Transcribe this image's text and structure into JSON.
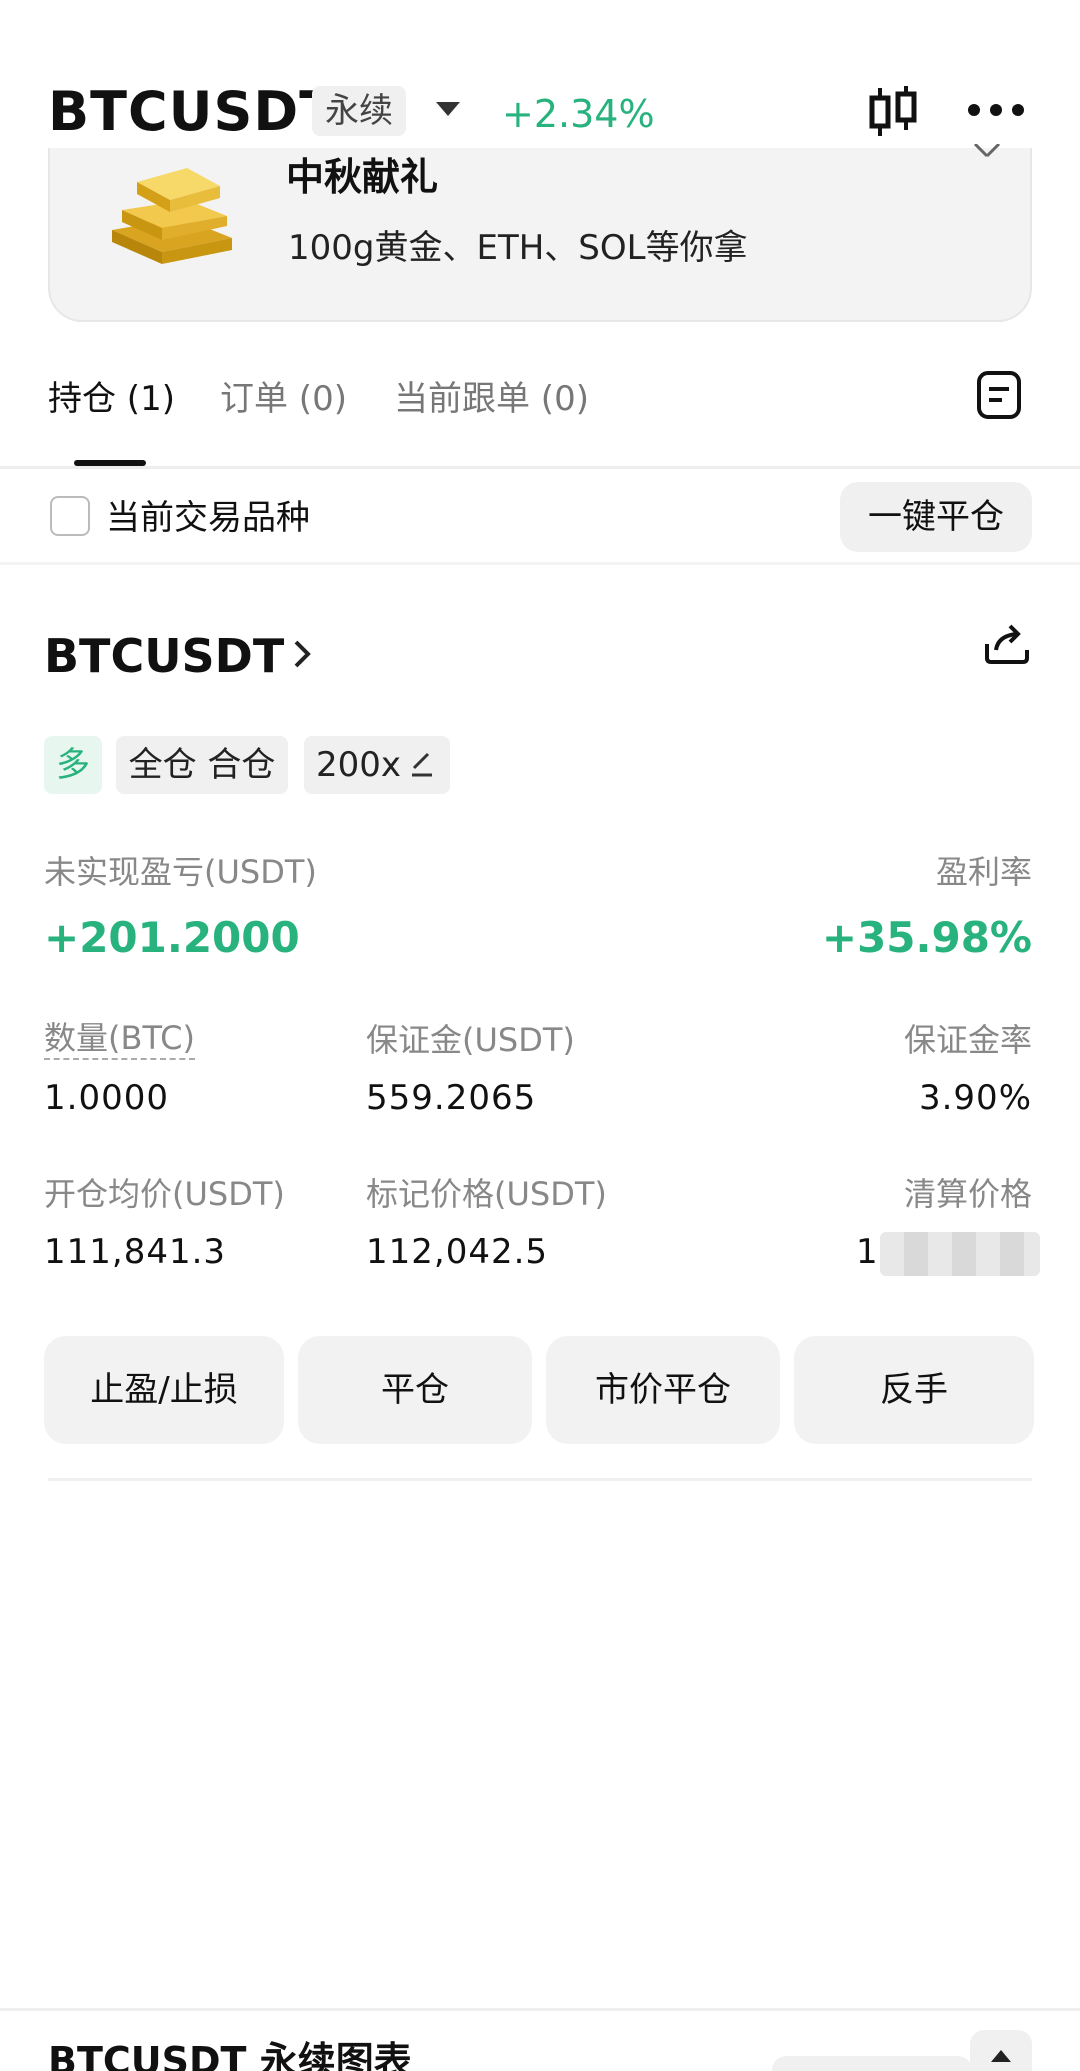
{
  "header": {
    "symbol": "BTCUSDT",
    "contract_type": "永续",
    "change_pct": "+2.34%",
    "icons": [
      "candlestick-chart-icon",
      "more-icon",
      "chevron-down-icon"
    ]
  },
  "banner": {
    "title": "中秋献礼",
    "subtitle": "100g黄金、ETH、SOL等你拿"
  },
  "tabs": [
    {
      "label": "持仓 (1)",
      "active": true
    },
    {
      "label": "订单 (0)",
      "active": false
    },
    {
      "label": "当前跟单 (0)",
      "active": false
    }
  ],
  "filter": {
    "checkbox_label": "当前交易品种",
    "close_all_label": "一键平仓"
  },
  "position": {
    "symbol": "BTCUSDT",
    "side_tag": "多",
    "margin_mode_tag": "全仓 合仓",
    "leverage_tag": "200x",
    "unrealized_pnl_label": "未实现盈亏(USDT)",
    "unrealized_pnl_value": "+201.2000",
    "roe_label": "盈利率",
    "roe_value": "+35.98%",
    "qty_label": "数量(BTC)",
    "qty_value": "1.0000",
    "margin_label": "保证金(USDT)",
    "margin_value": "559.2065",
    "margin_rate_label": "保证金率",
    "margin_rate_value": "3.90%",
    "entry_label": "开仓均价(USDT)",
    "entry_value": "111,841.3",
    "mark_label": "标记价格(USDT)",
    "mark_value": "112,042.5",
    "liq_label": "清算价格",
    "liq_value": "1"
  },
  "actions": {
    "tpsl": "止盈/止损",
    "close": "平仓",
    "market_close": "市价平仓",
    "reverse": "反手"
  },
  "bottom": {
    "chart_title": "BTCUSDT 永续图表"
  },
  "colors": {
    "accent_green": "#27b27e",
    "button_gray": "#f2f2f2"
  }
}
